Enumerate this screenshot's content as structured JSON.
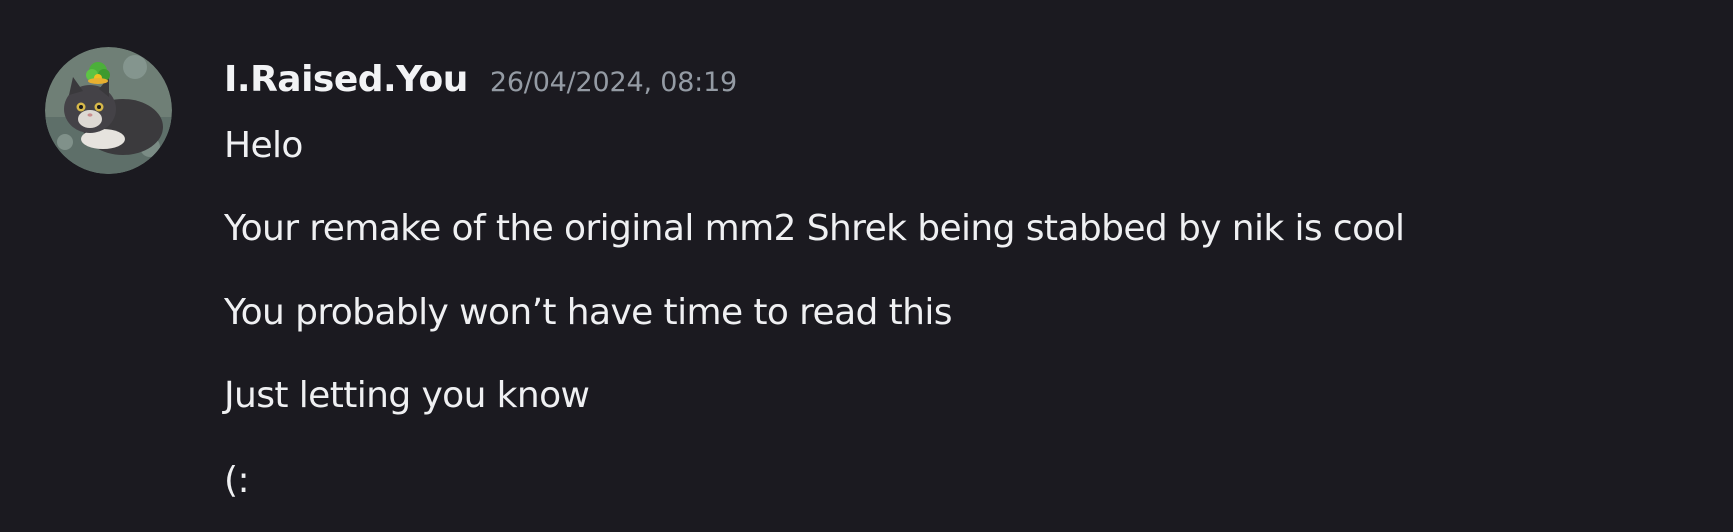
{
  "message": {
    "avatar_icon": "cat-avatar-icon",
    "username": "I.Raised.You",
    "timestamp": "26/04/2024, 08:19",
    "lines": [
      "Helo",
      "Your remake of the original mm2 Shrek being stabbed by nik is cool",
      "You probably won’t have time to read this",
      "Just letting you know",
      "(:"
    ]
  },
  "colors": {
    "background": "#1b1a20",
    "username": "#f2f3f5",
    "timestamp": "#949ba4",
    "text": "#eff0f2"
  }
}
